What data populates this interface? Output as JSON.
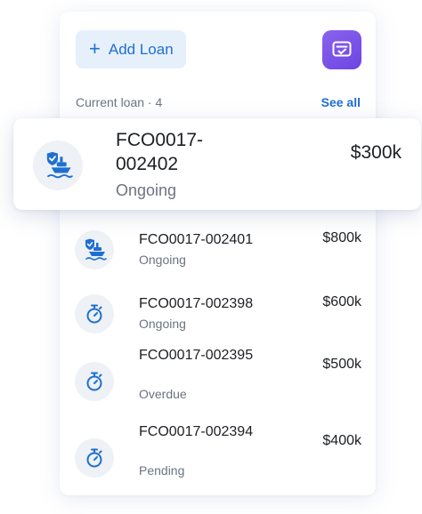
{
  "header": {
    "add_button_label": "Add Loan",
    "add_button_icon": "plus-icon",
    "action_button_icon": "checklist-card-icon",
    "accent_color": "#1f6fd1",
    "action_color": "#7b53e8"
  },
  "section": {
    "title": "Current loan · 4",
    "see_all_label": "See all"
  },
  "featured_loan": {
    "id": "FCO0017-002402",
    "status": "Ongoing",
    "amount": "$300k",
    "icon": "ship-shield-icon"
  },
  "loans": [
    {
      "id": "FCO0017-002401",
      "status": "Ongoing",
      "amount": "$800k",
      "icon": "ship-shield-icon"
    },
    {
      "id": "FCO0017-002398",
      "status": "Ongoing",
      "amount": "$600k",
      "icon": "stopwatch-icon"
    },
    {
      "id": "FCO0017-002395",
      "status": "Overdue",
      "amount": "$500k",
      "icon": "stopwatch-icon"
    },
    {
      "id": "FCO0017-002394",
      "status": "Pending",
      "amount": "$400k",
      "icon": "stopwatch-icon"
    }
  ]
}
